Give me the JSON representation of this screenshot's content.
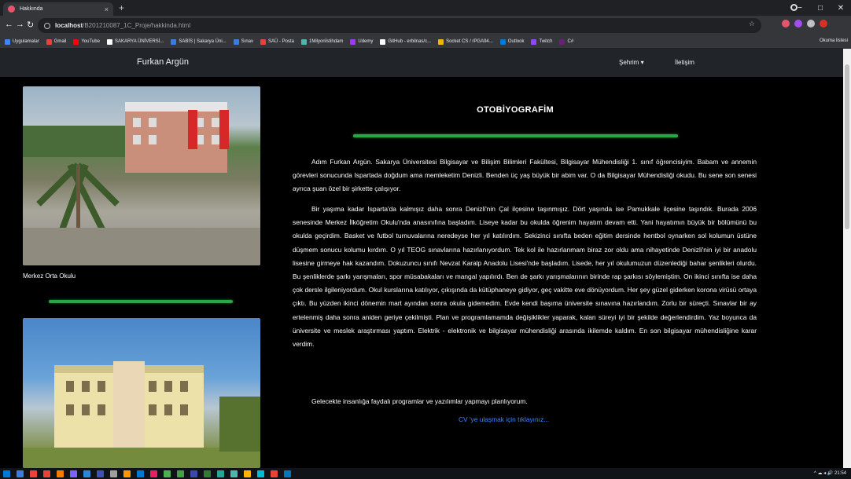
{
  "browser": {
    "tab_title": "Hakkında",
    "tab_close": "×",
    "new_tab": "+",
    "url_host": "localhost",
    "url_path": "/B201210087_1C_Proje/hakkinda.html",
    "window_controls": [
      "−",
      "□",
      "✕"
    ]
  },
  "bookmarks": [
    {
      "label": "Uygulamalar",
      "color": "#4285f4"
    },
    {
      "label": "Gmail",
      "color": "#ea4335"
    },
    {
      "label": "YouTube",
      "color": "#ff0000"
    },
    {
      "label": "SAKARYA ÜNİVERSİ...",
      "color": "#ffffff"
    },
    {
      "label": "SABİS | Sakarya Üni...",
      "color": "#3b7ddd"
    },
    {
      "label": "Sınav",
      "color": "#3b7ddd"
    },
    {
      "label": "SAÜ - Posta",
      "color": "#ea4335"
    },
    {
      "label": "1Milyonİstihdam",
      "color": "#4db6ac"
    },
    {
      "label": "Udemy",
      "color": "#a435f0"
    },
    {
      "label": "GitHub - erbilnas/c...",
      "color": "#ffffff"
    },
    {
      "label": "Socket CS / rPGA94...",
      "color": "#f4b400"
    },
    {
      "label": "Outlook",
      "color": "#0078d4"
    },
    {
      "label": "Twitch",
      "color": "#9146ff"
    },
    {
      "label": "C#",
      "color": "#68217a"
    }
  ],
  "bookmarks_right": "Okuma listesi",
  "navbar": {
    "brand": "Furkan Argün",
    "links": [
      "Şehrim ▾",
      "İletişim"
    ]
  },
  "sidebar": {
    "caption": "Merkez Orta Okulu"
  },
  "main": {
    "heading": "OTOBİYOGRAFİM",
    "paragraphs": [
      "Adım Furkan Argün. Sakarya Üniversitesi Bilgisayar ve Bilişim Bilimleri Fakültesi, Bilgisayar Mühendisliği 1. sınıf öğrencisiyim. Babam ve annemin görevleri sonucunda Ispartada doğdum ama memleketim Denizli. Benden üç yaş büyük bir abim var. O da Bilgisayar Mühendisliği okudu. Bu sene son senesi ayrıca şuan özel bir şirkette çalışıyor.",
      "Bir yaşıma kadar Isparta'da kalmışız daha sonra Denizli'nin Çal ilçesine taşınmışız. Dört yaşında ise Pamukkale ilçesine taşındık. Burada 2006 senesinde Merkez İlköğretim Okulu'nda anasınıfına başladım. Liseye kadar bu okulda öğrenim hayatım devam etti. Yani hayatımın büyük bir bölümünü bu okulda geçirdim. Basket ve futbol turnuvalarına neredeyse her yıl katılırdım. Sekizinci sınıfta beden eğitim dersinde hentbol oynarken sol kolumun üstüne düşmem sonucu kolumu kırdım. O yıl TEOG sınavlarına hazırlanıyordum. Tek kol ile hazırlanmam biraz zor oldu ama nihayetinde Denizli'nin iyi bir anadolu lisesine girmeye hak kazandım. Dokuzuncu sınıfı Nevzat Karalp Anadolu Lisesi'nde başladım. Lisede, her yıl okulumuzun düzenlediği bahar şenlikleri olurdu. Bu şenliklerde şarkı yarışmaları, spor müsabakaları ve mangal yapılırdı. Ben de şarkı yarışmalarının birinde rap şarkısı söylemiştim. On ikinci sınıfta ise daha çok dersle ilgileniyordum. Okul kurslarına katılıyor, çıkışında da kütüphaneye gidiyor, geç vakitte eve dönüyordum. Her şey güzel giderken korona virüsü ortaya çıktı. Bu yüzden ikinci dönemin mart ayından sonra okula gidemedim. Evde kendi başıma üniversite sınavına hazırlandım. Zorlu bir süreçti. Sınavlar bir ay ertelenmiş daha sonra aniden geriye çekilmişti. Plan ve programlamamda değişiklikler yaparak, kalan süreyi iyi bir şekilde değerlendirdim. Yaz boyunca da üniversite ve meslek araştırması yaptım. Elektrik - elektronik ve bilgisayar mühendisliği arasında ikilemde kaldım. En son bilgisayar mühendisliğine karar verdim.",
      "Gelecekte insanlığa faydalı programlar ve yazılımlar yapmayı planlıyorum."
    ],
    "cv_link": "CV 'ye ulaşmak için tıklayınız..."
  },
  "taskbar": {
    "tray_text": "^  ☁  ◂  🔊  21:54",
    "icon_colors": [
      "#0078d4",
      "#3b7ddd",
      "#ea4335",
      "#ea4335",
      "#f57c00",
      "#7b61ff",
      "#2b88d8",
      "#3f51b5",
      "#9e9e9e",
      "#ff9800",
      "#0078d4",
      "#e91e63",
      "#4caf50",
      "#43a047",
      "#3949ab",
      "#2e7d32",
      "#26a69a",
      "#4db6ac",
      "#ffb300",
      "#00bcd4",
      "#ea4335",
      "#0277bd"
    ]
  }
}
